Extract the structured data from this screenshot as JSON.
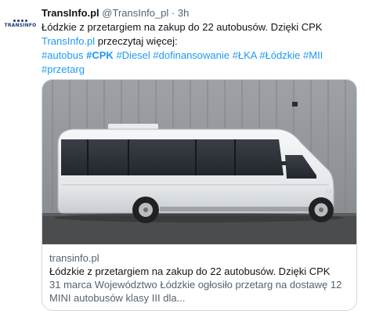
{
  "tweet": {
    "author": {
      "display_name": "TransInfo.pl",
      "handle": "@TransInfo_pl",
      "separator": "·",
      "time": "3h",
      "avatar_text": "TRANSINFO"
    },
    "text_line1": "Łódzkie z przetargiem na zakup do 22 autobusów. Dzięki CPK",
    "link_text": "TransInfo.pl",
    "text_line2_rest": " przeczytaj więcej:",
    "hashtags": [
      "#autobus",
      "#CPK",
      "#Diesel",
      "#dofinansowanie",
      "#ŁKA",
      "#Łódzkie",
      "#MII",
      "#przetarg"
    ]
  },
  "card": {
    "domain": "transinfo.pl",
    "title": "Łódzkie z przetargiem na zakup do 22 autobusów. Dzięki CPK",
    "description": "31 marca Województwo Łódzkie ogłosiło przetarg na dostawę 12 MINI autobusów klasy III dla...",
    "image_alt": "White minibus parked in front of a grey corrugated wall"
  }
}
